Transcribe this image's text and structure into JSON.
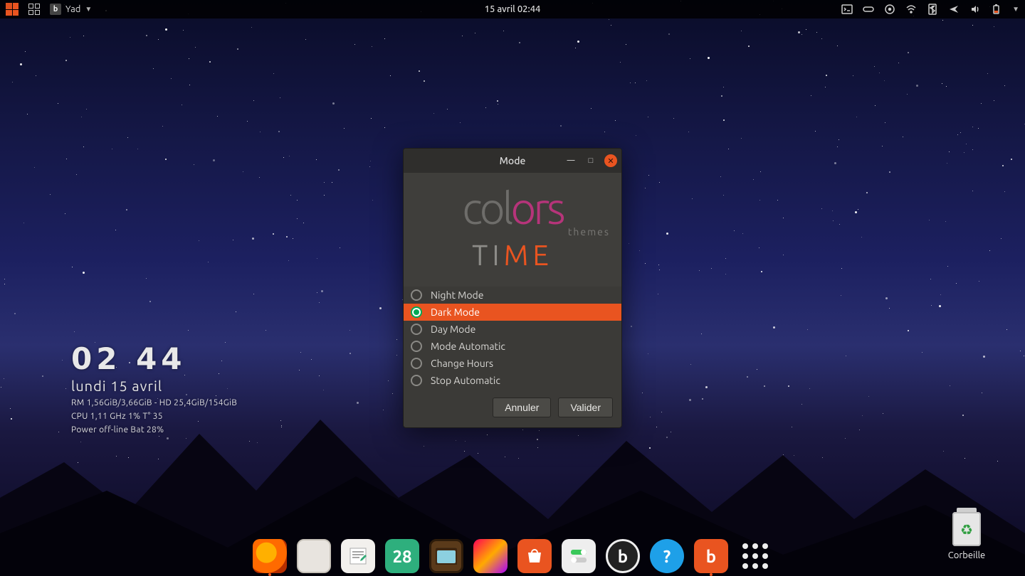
{
  "panel": {
    "active_app": "Yad",
    "datetime": "15 avril  02:44"
  },
  "conky": {
    "time": "02 44",
    "date": "lundi 15 avril",
    "ram": "RM 1,56GiB/3,66GiB - HD 25,4GiB/154GiB",
    "cpu": "CPU 1,11 GHz 1% T° 35",
    "power": "Power off-line Bat 28%"
  },
  "dialog": {
    "title": "Mode",
    "hero_word1a": "col",
    "hero_word1b": "ors",
    "hero_sub": "themes",
    "hero_word2a": "TI",
    "hero_word2b": "ME",
    "options": [
      {
        "label": "Night Mode",
        "selected": false
      },
      {
        "label": "Dark Mode",
        "selected": true
      },
      {
        "label": "Day Mode",
        "selected": false
      },
      {
        "label": "Mode Automatic",
        "selected": false
      },
      {
        "label": "Change Hours",
        "selected": false
      },
      {
        "label": "Stop Automatic",
        "selected": false
      }
    ],
    "cancel": "Annuler",
    "ok": "Valider"
  },
  "desktop": {
    "trash_label": "Corbeille"
  },
  "dock": {
    "calendar_day": "28"
  }
}
